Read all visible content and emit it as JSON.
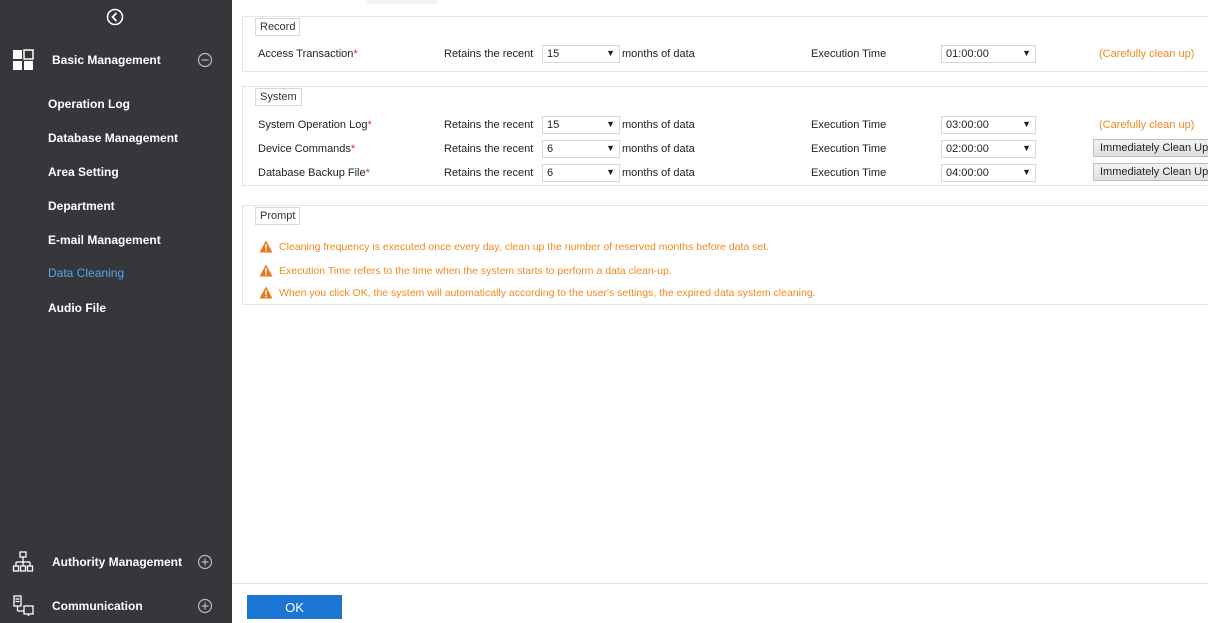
{
  "sidebar": {
    "groups": [
      {
        "label": "Basic Management",
        "icon": "grid-icon",
        "toggle": "collapse"
      },
      {
        "label": "Authority Management",
        "icon": "org-chart-icon",
        "toggle": "expand"
      },
      {
        "label": "Communication",
        "icon": "network-icon",
        "toggle": "expand"
      }
    ],
    "items": [
      {
        "label": "Operation Log"
      },
      {
        "label": "Database Management"
      },
      {
        "label": "Area Setting"
      },
      {
        "label": "Department"
      },
      {
        "label": "E-mail Management"
      },
      {
        "label": "Data Cleaning",
        "active": true
      },
      {
        "label": "Audio File"
      }
    ]
  },
  "record": {
    "legend": "Record",
    "rows": [
      {
        "name": "Access Transaction",
        "req": "*",
        "retain_label": "Retains the recent",
        "months": "15",
        "unit": "months of data",
        "exec_label": "Execution Time",
        "time": "01:00:00",
        "action": "(Carefully clean up)"
      }
    ]
  },
  "system": {
    "legend": "System",
    "rows": [
      {
        "name": "System Operation Log",
        "req": "*",
        "retain_label": "Retains the recent",
        "months": "15",
        "unit": "months of data",
        "exec_label": "Execution Time",
        "time": "03:00:00",
        "action": "(Carefully clean up)"
      },
      {
        "name": "Device Commands",
        "req": "*",
        "retain_label": "Retains the recent",
        "months": "6",
        "unit": "months of data",
        "exec_label": "Execution Time",
        "time": "02:00:00",
        "action": "Immediately Clean Up"
      },
      {
        "name": "Database Backup File",
        "req": "*",
        "retain_label": "Retains the recent",
        "months": "6",
        "unit": "months of data",
        "exec_label": "Execution Time",
        "time": "04:00:00",
        "action": "Immediately Clean Up"
      }
    ]
  },
  "prompt": {
    "legend": "Prompt",
    "lines": [
      "Cleaning frequency is executed once every day, clean up the number of reserved months before data set.",
      "Execution Time refers to the time when the system starts to perform a data clean-up.",
      "When you click OK, the system will automatically according to the user's settings, the expired data system cleaning."
    ]
  },
  "footer": {
    "ok_label": "OK"
  },
  "colors": {
    "sidebar_bg": "#36373b",
    "active_item": "#5ea1e6",
    "warning": "#f08a1f",
    "primary_button": "#1c75d2"
  }
}
